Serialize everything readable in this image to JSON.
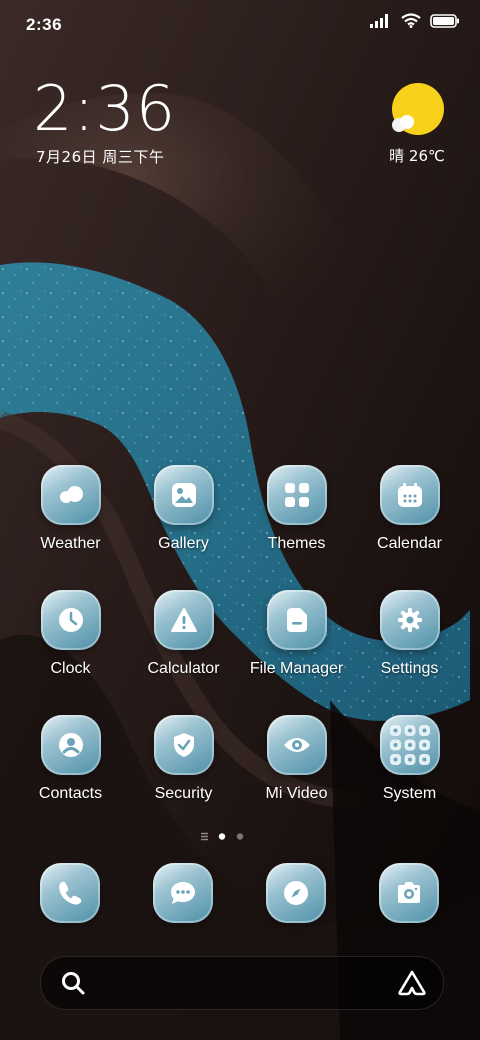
{
  "status_bar": {
    "time": "2:36",
    "icons": [
      "signal-icon",
      "wifi-icon",
      "battery-icon"
    ]
  },
  "clock_widget": {
    "time": "2:36",
    "date": "7月26日 周三下午"
  },
  "weather_widget": {
    "text": "晴 26℃",
    "icon": "sunny-partly-cloudy-icon",
    "sun_color": "#f7d11c"
  },
  "apps": [
    {
      "label": "Weather",
      "icon": "cloud-icon"
    },
    {
      "label": "Gallery",
      "icon": "image-icon"
    },
    {
      "label": "Themes",
      "icon": "grid-icon"
    },
    {
      "label": "Calendar",
      "icon": "calendar-icon"
    },
    {
      "label": "Clock",
      "icon": "clock-icon"
    },
    {
      "label": "Calculator",
      "icon": "warning-triangle-icon"
    },
    {
      "label": "File Manager",
      "icon": "folder-icon"
    },
    {
      "label": "Settings",
      "icon": "gear-icon"
    },
    {
      "label": "Contacts",
      "icon": "person-icon"
    },
    {
      "label": "Security",
      "icon": "shield-check-icon"
    },
    {
      "label": "Mi Video",
      "icon": "eye-icon"
    },
    {
      "label": "System",
      "icon": "folder-grid-icon"
    }
  ],
  "page_indicator": {
    "pages": 2,
    "active": 0
  },
  "dock": [
    {
      "name": "phone",
      "icon": "phone-icon"
    },
    {
      "name": "messages",
      "icon": "chat-bubble-icon"
    },
    {
      "name": "browser",
      "icon": "compass-icon"
    },
    {
      "name": "camera",
      "icon": "camera-icon"
    }
  ],
  "search_bar": {
    "left_icon": "search-icon",
    "right_icon": "assistant-icon"
  },
  "colors": {
    "icon_tint": "#4e8fa8",
    "accent": "#5a98b0"
  }
}
